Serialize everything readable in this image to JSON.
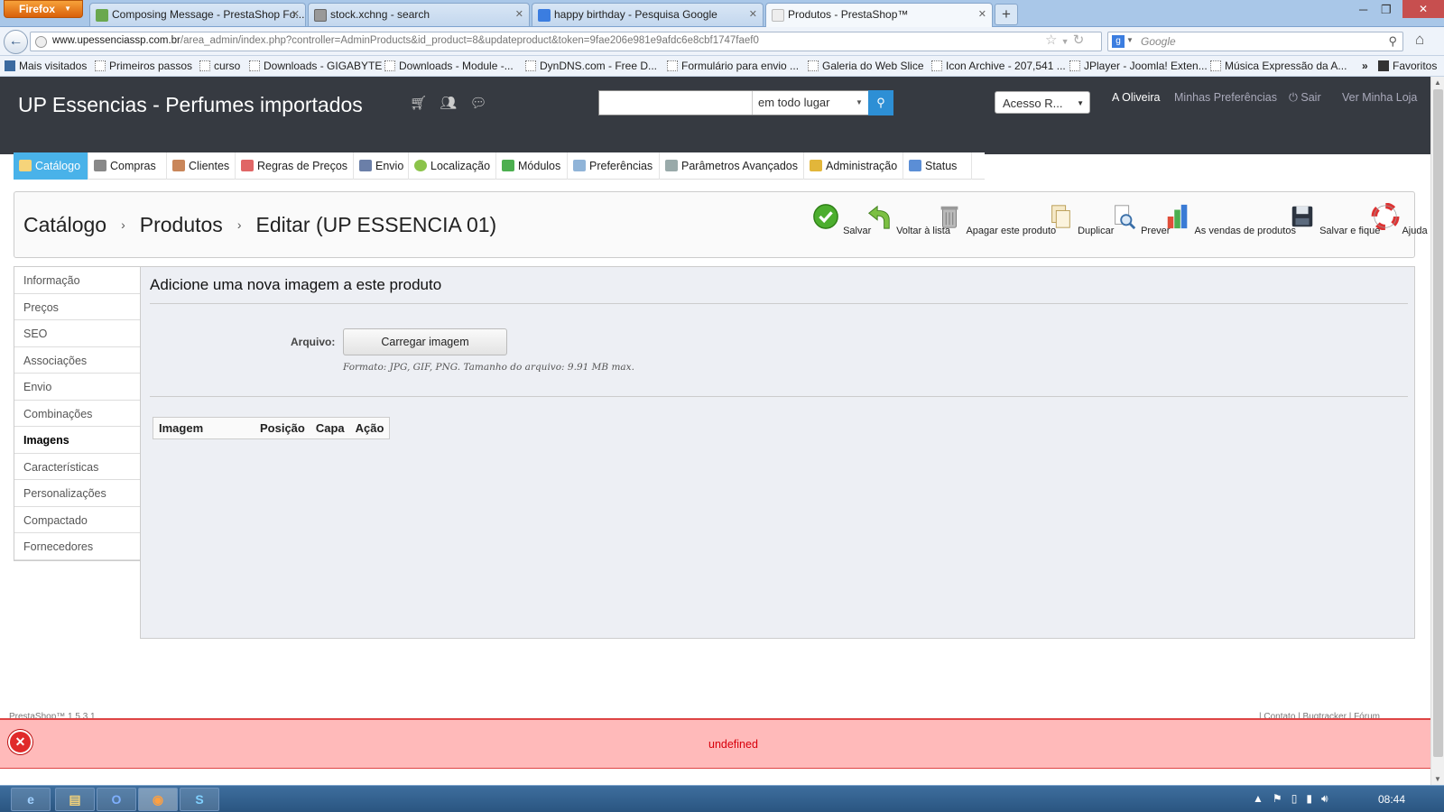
{
  "browser": {
    "app_button": "Firefox",
    "tabs": [
      {
        "title": "Composing Message - PrestaShop Fo...",
        "favicon_color": "#6aa84f"
      },
      {
        "title": "stock.xchng - search",
        "favicon_color": "#999999"
      },
      {
        "title": "happy birthday - Pesquisa Google",
        "favicon_color": "#3b7de0"
      },
      {
        "title": "Produtos - PrestaShop™",
        "favicon_color": "#dddddd"
      }
    ],
    "url_domain": "www.upessenciassp.com.br",
    "url_path": "/area_admin/index.php?controller=AdminProducts&id_product=8&updateproduct&token=9fae206e981e9afdc6e8cbf1747faef0",
    "search_placeholder": "Google",
    "bookmarks": [
      "Mais visitados",
      "Primeiros passos",
      "curso",
      "Downloads - GIGABYTE",
      "Downloads - Module -...",
      "DynDNS.com - Free D...",
      "Formulário para envio ...",
      "Galeria do Web Slice",
      "Icon Archive - 207,541 ...",
      "JPlayer - Joomla! Exten...",
      "Música Expressão da A..."
    ],
    "bookmarks_overflow": "»",
    "favorites_label": "Favoritos"
  },
  "header": {
    "shop_name": "UP Essencias - Perfumes importados",
    "search_scope": "em todo lugar",
    "quick_access": "Acesso R...",
    "user_name": "A Oliveira",
    "preferences": "Minhas Preferências",
    "logout": "Sair",
    "view_store": "Ver Minha Loja"
  },
  "menu": {
    "items": [
      "Catálogo",
      "Compras",
      "Clientes",
      "Regras de Preços",
      "Envio",
      "Localização",
      "Módulos",
      "Preferências",
      "Parâmetros Avançados",
      "Administração",
      "Status"
    ]
  },
  "toolbar": {
    "breadcrumb": [
      "Catálogo",
      "Produtos",
      "Editar (UP ESSENCIA 01)"
    ],
    "buttons": [
      "Salvar",
      "Voltar à lista",
      "Apagar este produto",
      "Duplicar",
      "Prever",
      "As vendas de produtos",
      "Salvar e fique",
      "Ajuda"
    ]
  },
  "sidenav": {
    "items": [
      "Informação",
      "Preços",
      "SEO",
      "Associações",
      "Envio",
      "Combinações",
      "Imagens",
      "Características",
      "Personalizações",
      "Compactado",
      "Fornecedores"
    ],
    "active": "Imagens"
  },
  "panel": {
    "title": "Adicione uma nova imagem a este produto",
    "file_label": "Arquivo:",
    "upload_button": "Carregar imagem",
    "format_hint": "Formato: JPG, GIF, PNG. Tamanho do arquivo: 9.91 MB max.",
    "table_headers": [
      "Imagem",
      "Posição",
      "Capa",
      "Ação"
    ]
  },
  "footer": {
    "left": "PrestaShop™ 1.5.3.1",
    "right": "| Contato | Bugtracker | Fórum"
  },
  "error": {
    "message": "undefined"
  },
  "taskbar": {
    "clock": "08:44"
  },
  "colors": {
    "header_bg": "#363a41",
    "menu_active": "#49b2e9",
    "error_bg": "#ffbaba",
    "error_text": "#d8000c"
  }
}
